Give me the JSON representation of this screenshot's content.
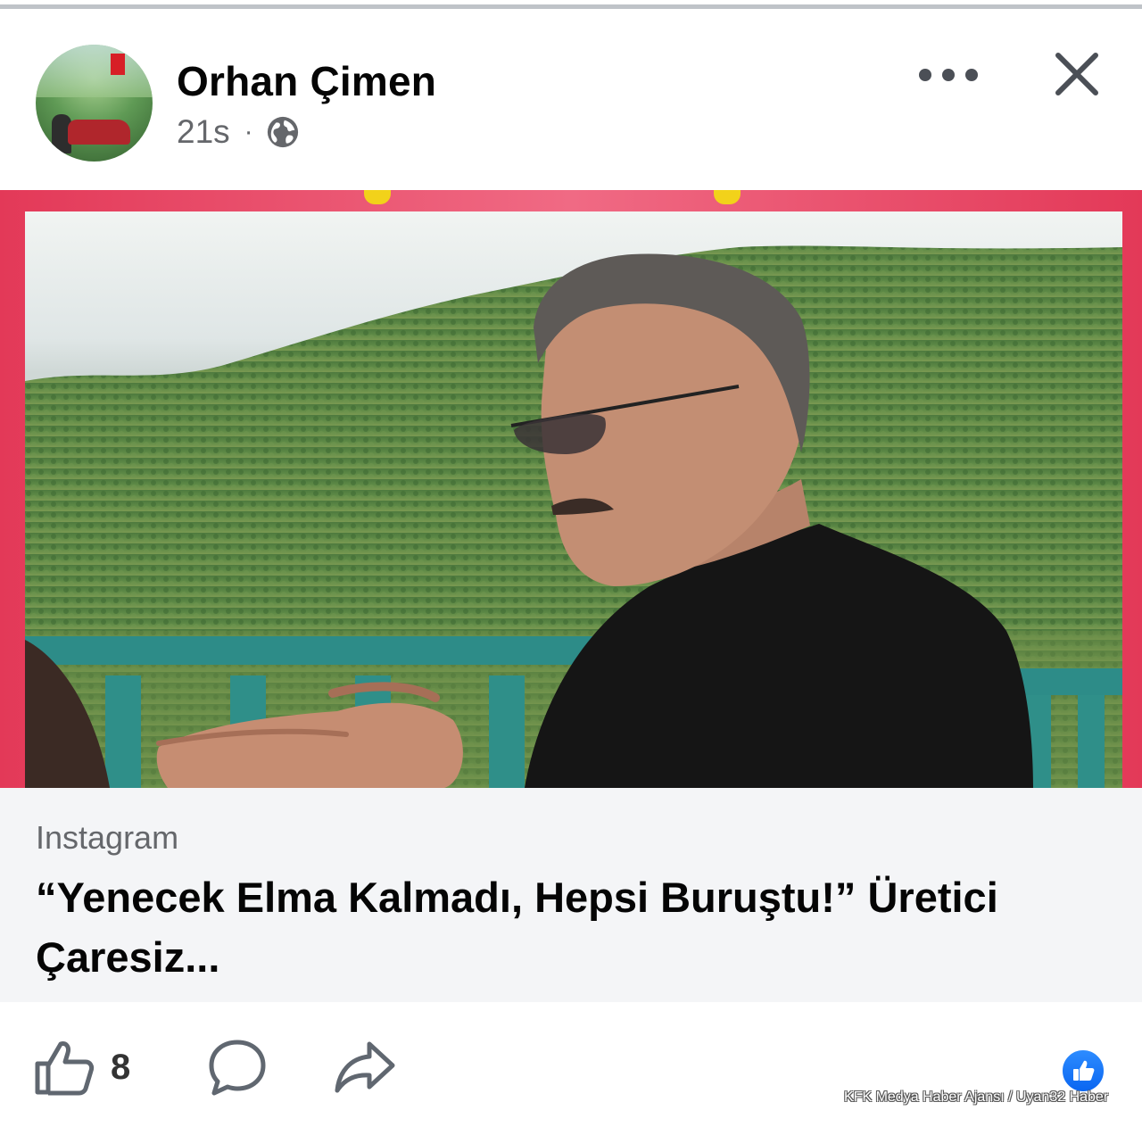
{
  "post": {
    "author": "Orhan Çimen",
    "timestamp": "21s",
    "separator": "·",
    "visibility_icon": "globe-icon"
  },
  "header_actions": {
    "more_icon": "more-icon",
    "close_icon": "close-icon"
  },
  "link_preview": {
    "source": "Instagram",
    "title": "“Yenecek Elma Kalmadı, Hepsi Buruştu!” Üretici Çaresiz..."
  },
  "actions": {
    "like_icon": "like-icon",
    "like_count": "8",
    "comment_icon": "comment-icon",
    "share_icon": "share-icon",
    "reaction_icon": "like-reaction-icon"
  },
  "watermark": "KFK Medya Haber Ajansı / Uyan32 Haber",
  "colors": {
    "frame": "#e33958",
    "reaction_blue": "#0a66f1",
    "secondary_text": "#65676b"
  }
}
